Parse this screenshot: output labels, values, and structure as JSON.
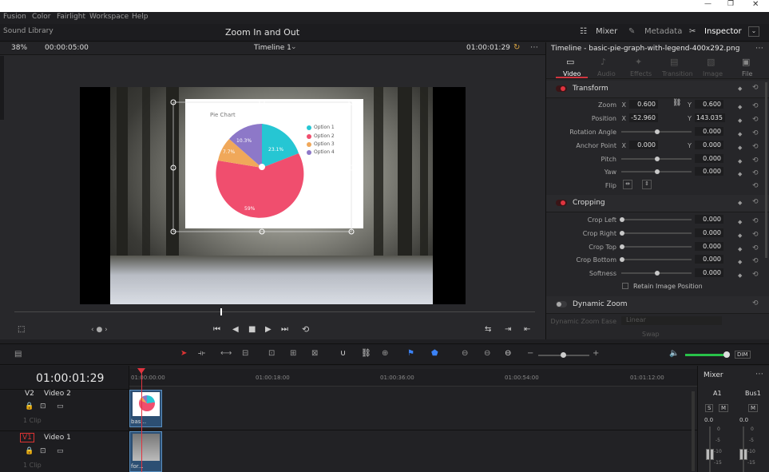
{
  "window": {
    "min": "—",
    "max": "❐",
    "close": "✕"
  },
  "menu": [
    "Fusion",
    "Color",
    "Fairlight",
    "Workspace",
    "Help"
  ],
  "header": {
    "left": "Sound Library",
    "title": "Zoom In and Out",
    "mixer": "Mixer",
    "metadata": "Metadata",
    "inspector": "Inspector"
  },
  "viewer": {
    "zoom": "38%",
    "tc_left": "00:00:05:00",
    "timeline_name": "Timeline 1",
    "tc_right": "01:00:01:29"
  },
  "chart_in_viewer": {
    "title": "Pie Chart",
    "legend": [
      "Option 1",
      "Option 2",
      "Option 3",
      "Option 4"
    ],
    "labels": {
      "a": "23.1%",
      "b": "59%",
      "c": "7.7%",
      "d": "10.3%"
    },
    "colors": [
      "#26c6d3",
      "#f04e6e",
      "#f0a85a",
      "#8d78c8"
    ]
  },
  "inspector": {
    "file_title": "Timeline - basic-pie-graph-with-legend-400x292.png",
    "tabs": [
      "Video",
      "Audio",
      "Effects",
      "Transition",
      "Image",
      "File"
    ],
    "transform": "Transform",
    "zoom_label": "Zoom",
    "zoom_x": "0.600",
    "zoom_y": "0.600",
    "position_label": "Position",
    "pos_x": "-52.960",
    "pos_y": "143.035",
    "rotation_label": "Rotation Angle",
    "rotation": "0.000",
    "anchor_label": "Anchor Point",
    "anchor_x": "0.000",
    "anchor_y": "0.000",
    "pitch_label": "Pitch",
    "pitch": "0.000",
    "yaw_label": "Yaw",
    "yaw": "0.000",
    "flip_label": "Flip",
    "cropping": "Cropping",
    "crop_left_label": "Crop Left",
    "crop_left": "0.000",
    "crop_right_label": "Crop Right",
    "crop_right": "0.000",
    "crop_top_label": "Crop Top",
    "crop_top": "0.000",
    "crop_bottom_label": "Crop Bottom",
    "crop_bottom": "0.000",
    "softness_label": "Softness",
    "softness": "0.000",
    "retain": "Retain Image Position",
    "dynamic_zoom": "Dynamic Zoom",
    "dz_ease_label": "Dynamic Zoom Ease",
    "dz_ease": "Linear",
    "swap": "Swap",
    "axis_x": "X",
    "axis_y": "Y"
  },
  "timeline": {
    "timecode": "01:00:01:29",
    "ruler": [
      "01:00:00:00",
      "01:00:18:00",
      "01:00:36:00",
      "01:00:54:00",
      "01:01:12:00"
    ],
    "tracks": [
      {
        "id": "V2",
        "name": "Video 2",
        "clips": "1 Clip",
        "clip_label": "bas..."
      },
      {
        "id": "V1",
        "name": "Video 1",
        "clips": "1 Clip",
        "clip_label": "for..."
      }
    ]
  },
  "mixer": {
    "title": "Mixer",
    "a1": "A1",
    "bus1": "Bus1",
    "s": "S",
    "m": "M",
    "a1_val": "0.0",
    "bus_val": "0.0",
    "scale": [
      "0",
      "-5",
      "-10",
      "-15"
    ]
  }
}
